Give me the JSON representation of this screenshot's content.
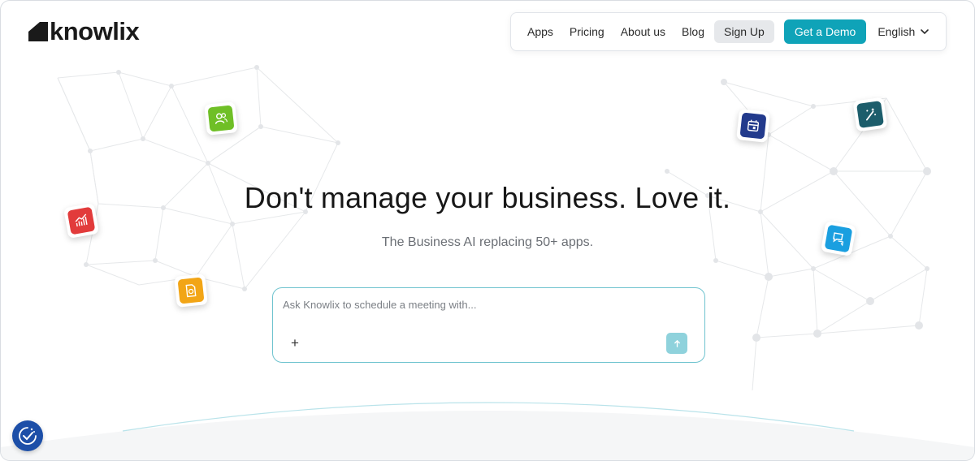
{
  "brand": {
    "name": "knowlix"
  },
  "nav": {
    "links": [
      "Apps",
      "Pricing",
      "About us",
      "Blog"
    ],
    "signup_label": "Sign Up",
    "demo_label": "Get a Demo",
    "language": "English"
  },
  "hero": {
    "headline": "Don't manage your business. Love it.",
    "subline": "The Business AI replacing 50+ apps."
  },
  "ask": {
    "placeholder": "Ask Knowlix to schedule a meeting with...",
    "value": "",
    "plus_label": "+"
  },
  "floating_icons": [
    {
      "name": "people-icon",
      "color": "#6fbf26"
    },
    {
      "name": "chart-icon",
      "color": "#e23b3b"
    },
    {
      "name": "document-icon",
      "color": "#f2a516"
    },
    {
      "name": "calendar-icon",
      "color": "#223a8c"
    },
    {
      "name": "magic-wand-icon",
      "color": "#1c5d6b"
    },
    {
      "name": "chat-icon",
      "color": "#1a9fe0"
    }
  ],
  "colors": {
    "accent": "#0fa3b8",
    "send_button": "#8fd2dc",
    "cookie_badge": "#1d4fa8"
  }
}
